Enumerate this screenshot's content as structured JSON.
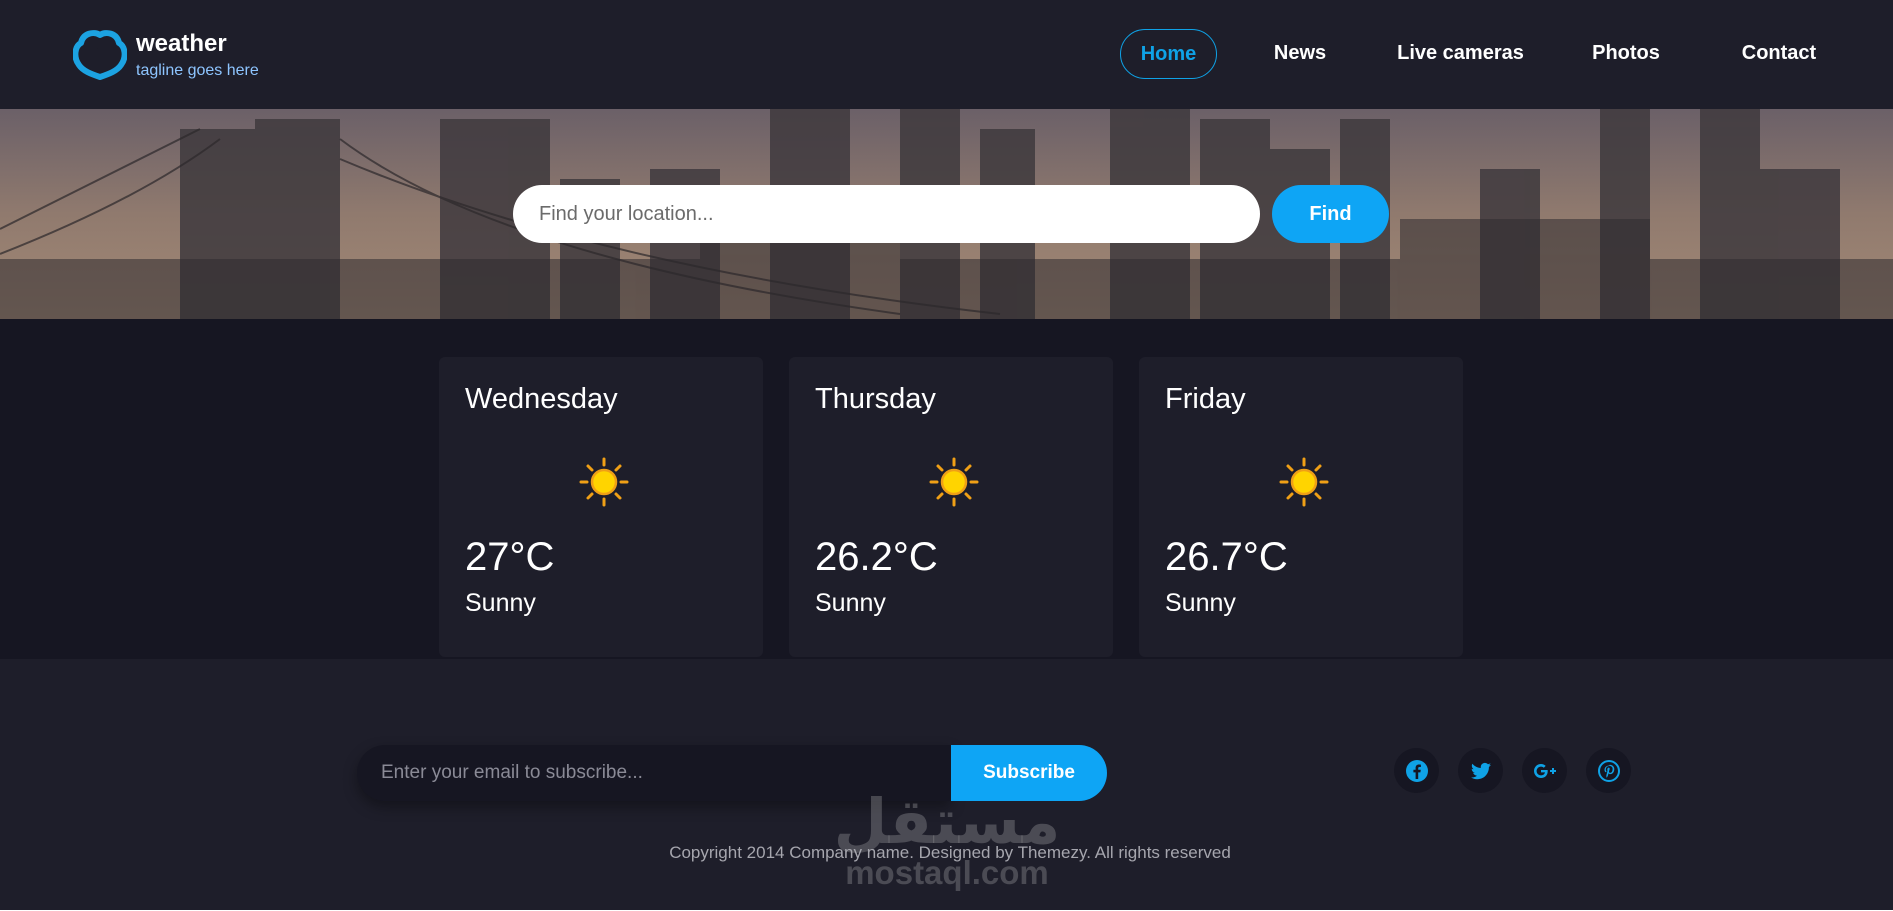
{
  "brand": {
    "name": "weather",
    "tagline": "tagline goes here",
    "accent": "#0fa2e6"
  },
  "nav": {
    "items": [
      {
        "label": "Home",
        "active": true
      },
      {
        "label": "News",
        "active": false
      },
      {
        "label": "Live cameras",
        "active": false
      },
      {
        "label": "Photos",
        "active": false
      },
      {
        "label": "Contact",
        "active": false
      }
    ]
  },
  "search": {
    "placeholder": "Find your location...",
    "value": "",
    "button_label": "Find"
  },
  "forecast": [
    {
      "day": "Wednesday",
      "icon": "sun-icon",
      "temp": "27°C",
      "condition": "Sunny"
    },
    {
      "day": "Thursday",
      "icon": "sun-icon",
      "temp": "26.2°C",
      "condition": "Sunny"
    },
    {
      "day": "Friday",
      "icon": "sun-icon",
      "temp": "26.7°C",
      "condition": "Sunny"
    }
  ],
  "footer": {
    "subscribe_placeholder": "Enter your email to subscribe...",
    "subscribe_button": "Subscribe",
    "social": [
      "facebook-icon",
      "twitter-icon",
      "google-plus-icon",
      "pinterest-icon"
    ],
    "copyright": "Copyright 2014 Company name. Designed by Themezy. All rights reserved"
  },
  "watermark": {
    "logo": "مستقل",
    "text": "mostaql.com"
  }
}
